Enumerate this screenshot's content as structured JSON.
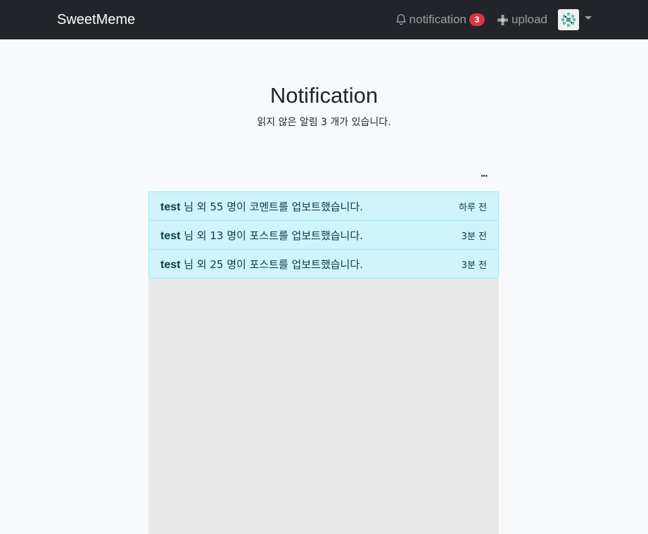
{
  "navbar": {
    "brand": "SweetMeme",
    "notification_label": "notification",
    "notification_count": "3",
    "upload_label": "upload"
  },
  "header": {
    "title": "Notification",
    "subtitle": "읽지 않은 알림 3 개가 있습니다."
  },
  "more_label": "...",
  "notifications": [
    {
      "user": "test",
      "message": " 님 외 55 명이 코멘트를 업보트했습니다.",
      "time": "하루 전"
    },
    {
      "user": "test",
      "message": " 님 외 13 명이 포스트를 업보트했습니다.",
      "time": "3분 전"
    },
    {
      "user": "test",
      "message": " 님 외 25 명이 포스트를 업보트했습니다.",
      "time": "3분 전"
    }
  ],
  "colors": {
    "navbar_bg": "#212529",
    "badge": "#dc3545",
    "item_bg": "#cff4fc",
    "item_border": "#9eeaf9"
  }
}
